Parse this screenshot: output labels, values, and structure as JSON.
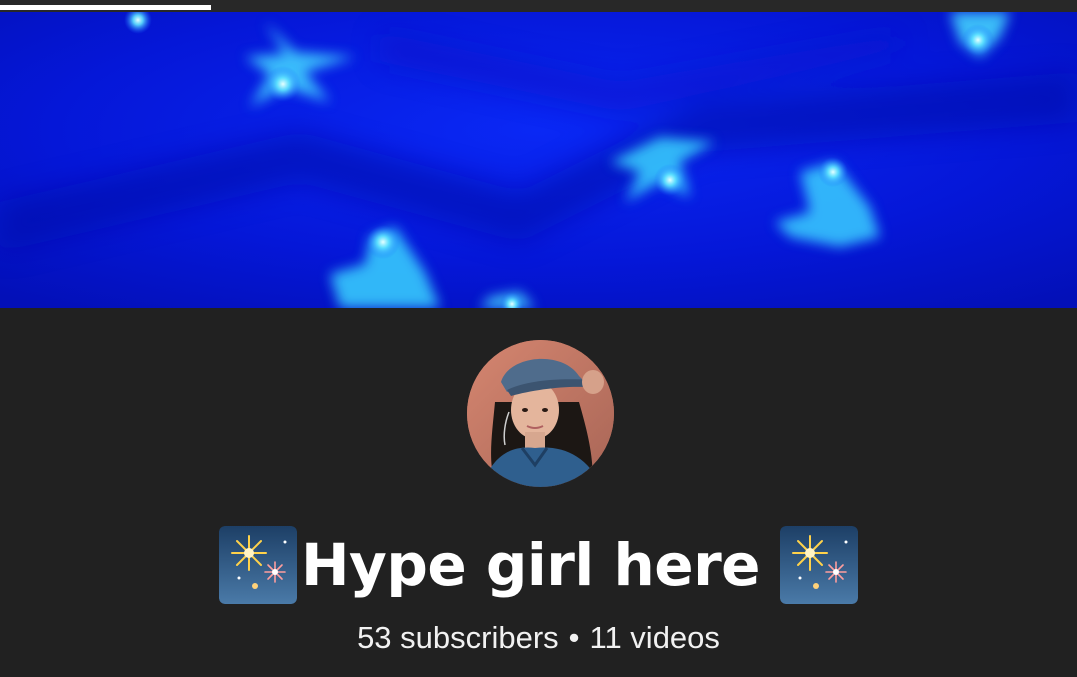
{
  "upload_progress": {
    "fraction": 0.196
  },
  "banner": {
    "image": "blue-glowing-stars-banner"
  },
  "avatar": {
    "image": "profile-photo-girl-in-cap"
  },
  "channel": {
    "name": "Hype girl here",
    "leading_icon": "fireworks-icon",
    "trailing_icon": "fireworks-icon"
  },
  "stats": {
    "subscribers": "53 subscribers",
    "separator": "•",
    "videos": "11 videos"
  },
  "colors": {
    "background": "#212121",
    "banner_blue": "#0718e6",
    "text": "#ffffff"
  }
}
